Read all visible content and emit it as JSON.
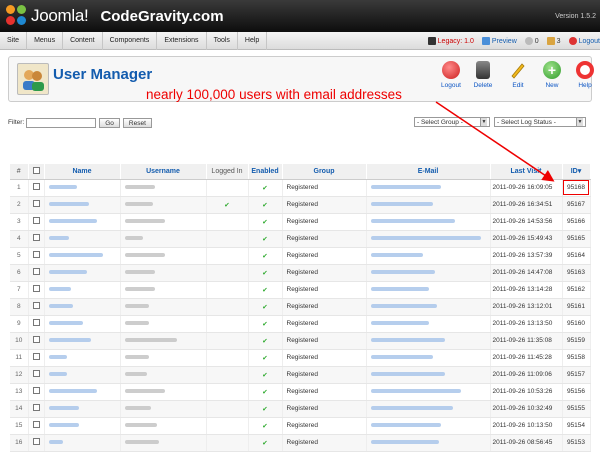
{
  "header": {
    "logo_text": "Joomla!",
    "site_name": "CodeGravity.com",
    "version": "Version 1.5.2"
  },
  "menu": {
    "items": [
      "Site",
      "Menus",
      "Content",
      "Components",
      "Extensions",
      "Tools",
      "Help"
    ],
    "legacy": "Legacy: 1.0",
    "preview": "Preview",
    "messages": "0",
    "users": "3",
    "logout": "Logout"
  },
  "toolbar": {
    "title": "User Manager",
    "buttons": [
      "Logout",
      "Delete",
      "Edit",
      "New",
      "Help"
    ]
  },
  "annotation": "nearly 100,000 users with email addresses",
  "filter": {
    "label": "Filter:",
    "go": "Go",
    "reset": "Reset",
    "group_select": "- Select Group -",
    "log_select": "- Select Log Status -"
  },
  "table": {
    "headers": [
      "#",
      "",
      "Name",
      "Username",
      "Logged In",
      "Enabled",
      "Group",
      "E-Mail",
      "Last Visit",
      "ID"
    ],
    "rows": [
      {
        "n": "1",
        "logged": false,
        "group": "Registered",
        "last": "2011-09-26 16:09:05",
        "id": "95168"
      },
      {
        "n": "2",
        "logged": false,
        "group": "Registered",
        "last": "2011-09-26 16:34:51",
        "id": "95167"
      },
      {
        "n": "3",
        "logged": false,
        "group": "Registered",
        "last": "2011-09-26 14:53:56",
        "id": "95166"
      },
      {
        "n": "4",
        "logged": false,
        "group": "Registered",
        "last": "2011-09-26 15:49:43",
        "id": "95165"
      },
      {
        "n": "5",
        "logged": false,
        "group": "Registered",
        "last": "2011-09-26 13:57:39",
        "id": "95164"
      },
      {
        "n": "6",
        "logged": false,
        "group": "Registered",
        "last": "2011-09-26 14:47:08",
        "id": "95163"
      },
      {
        "n": "7",
        "logged": false,
        "group": "Registered",
        "last": "2011-09-26 13:14:28",
        "id": "95162"
      },
      {
        "n": "8",
        "logged": false,
        "group": "Registered",
        "last": "2011-09-26 13:12:01",
        "id": "95161"
      },
      {
        "n": "9",
        "logged": false,
        "group": "Registered",
        "last": "2011-09-26 13:13:50",
        "id": "95160"
      },
      {
        "n": "10",
        "logged": false,
        "group": "Registered",
        "last": "2011-09-26 11:35:08",
        "id": "95159"
      },
      {
        "n": "11",
        "logged": false,
        "group": "Registered",
        "last": "2011-09-26 11:45:28",
        "id": "95158"
      },
      {
        "n": "12",
        "logged": false,
        "group": "Registered",
        "last": "2011-09-26 11:09:06",
        "id": "95157"
      },
      {
        "n": "13",
        "logged": false,
        "group": "Registered",
        "last": "2011-09-26 10:53:26",
        "id": "95156"
      },
      {
        "n": "14",
        "logged": false,
        "group": "Registered",
        "last": "2011-09-26 10:32:49",
        "id": "95155"
      },
      {
        "n": "15",
        "logged": false,
        "group": "Registered",
        "last": "2011-09-26 10:13:50",
        "id": "95154"
      },
      {
        "n": "16",
        "logged": false,
        "group": "Registered",
        "last": "2011-09-26 08:56:45",
        "id": "95153"
      }
    ]
  },
  "colors": {
    "accent": "#135cae",
    "annotation": "#e00000",
    "check": "#2aa82a"
  }
}
